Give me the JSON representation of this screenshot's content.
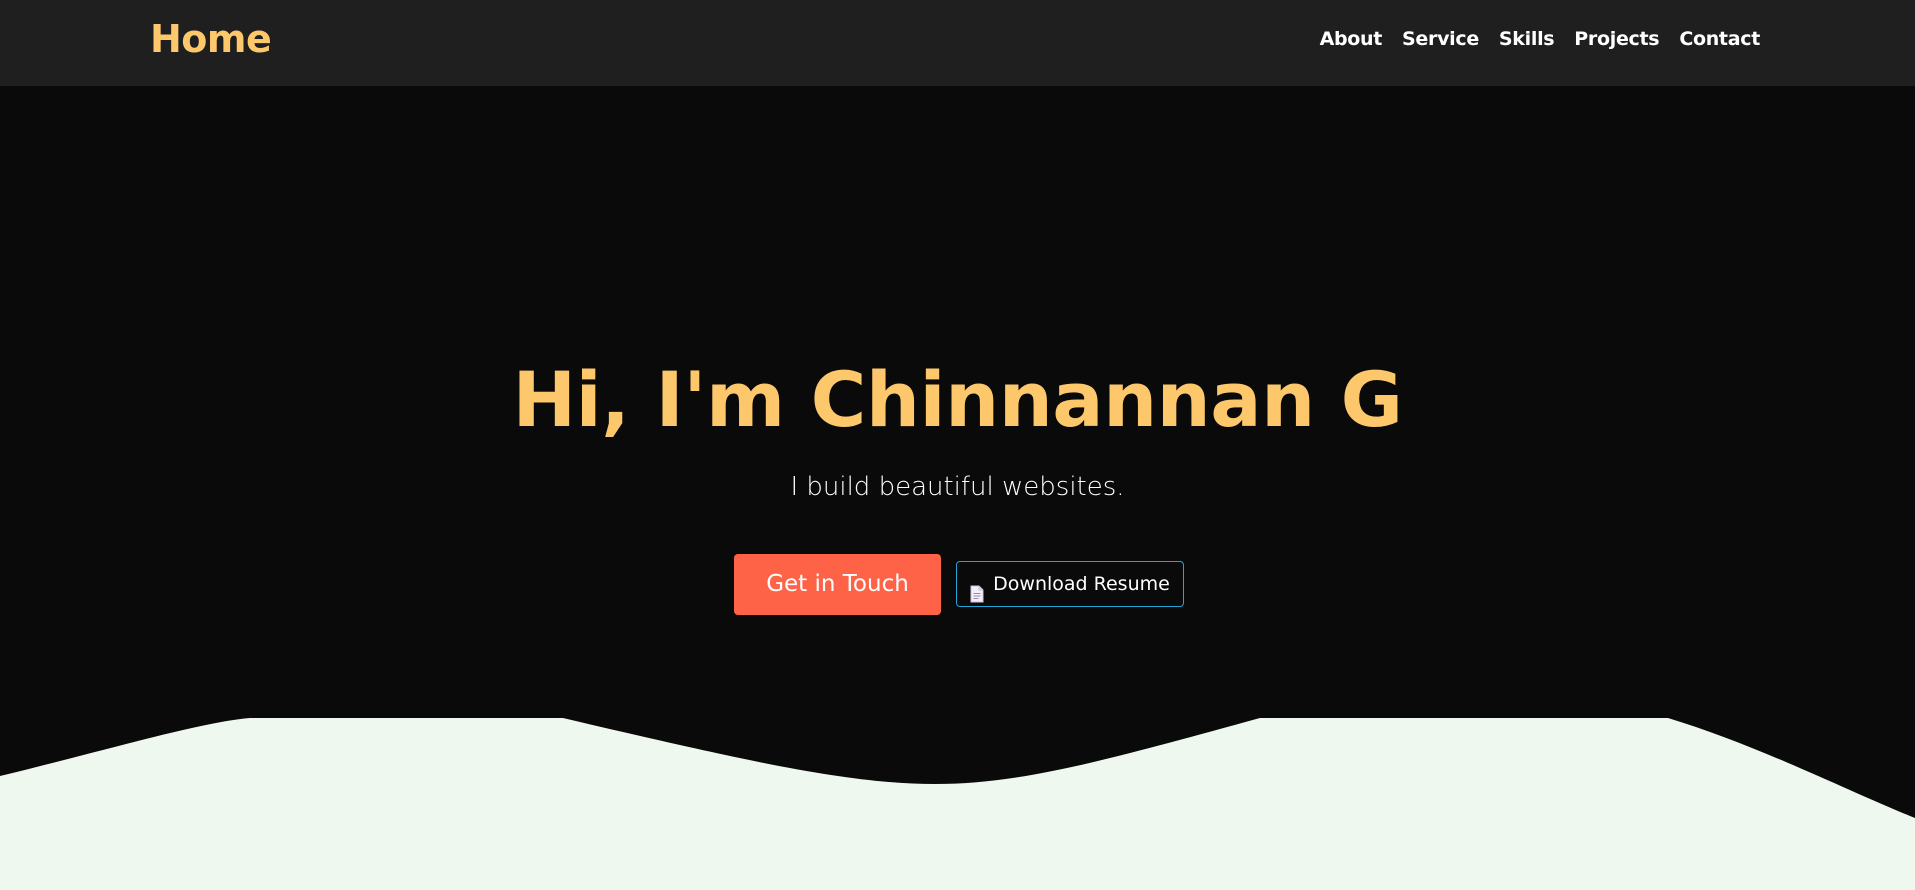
{
  "navbar": {
    "brand": "Home",
    "links": [
      "About",
      "Service",
      "Skills",
      "Projects",
      "Contact"
    ]
  },
  "hero": {
    "title": "Hi, I'm Chinnannan G",
    "subtitle": "I build beautiful websites.",
    "primary_button": "Get in Touch",
    "secondary_button": "Download Resume",
    "secondary_icon": "document-icon"
  },
  "colors": {
    "navbar_bg": "#1f1f1f",
    "hero_bg": "#0a0a0a",
    "accent": "#fdc76b",
    "primary_button": "#ff6347",
    "outline_border": "#1fa6d8",
    "wave_fill": "#eef8ee"
  }
}
